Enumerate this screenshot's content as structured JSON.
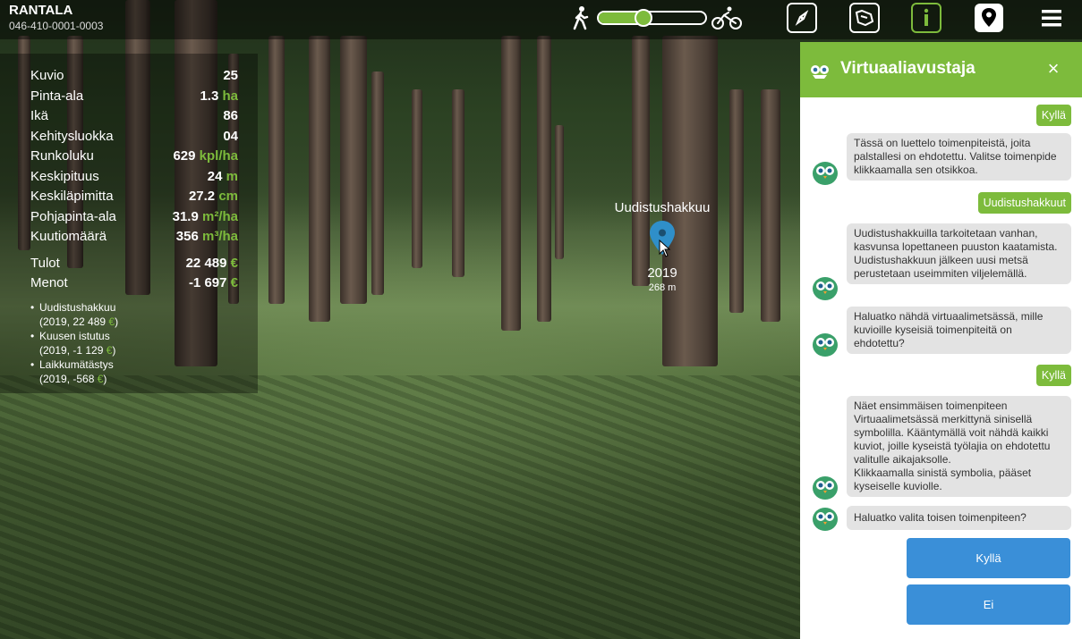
{
  "header": {
    "title": "RANTALA",
    "subtitle": "046-410-0001-0003"
  },
  "speed_slider": {
    "value_fraction": 0.42
  },
  "toolbar": {
    "buttons": [
      "compass-icon",
      "map-view-icon",
      "info-icon",
      "location-pin-icon",
      "menu-icon"
    ],
    "active": "info-icon"
  },
  "stats": {
    "rows": [
      {
        "label": "Kuvio",
        "value": "25",
        "unit": ""
      },
      {
        "label": "Pinta-ala",
        "value": "1.3",
        "unit": "ha"
      },
      {
        "label": "Ikä",
        "value": "86",
        "unit": ""
      },
      {
        "label": "Kehitysluokka",
        "value": "04",
        "unit": ""
      },
      {
        "label": "Runkoluku",
        "value": "629",
        "unit": "kpl/ha"
      },
      {
        "label": "Keskipituus",
        "value": "24",
        "unit": "m"
      },
      {
        "label": "Keskiläpimitta",
        "value": "27.2",
        "unit": "cm"
      },
      {
        "label": "Pohjapinta-ala",
        "value": "31.9",
        "unit": "m²/ha"
      },
      {
        "label": "Kuutiomäärä",
        "value": "356",
        "unit": "m³/ha"
      }
    ],
    "finance": [
      {
        "label": "Tulot",
        "value": "22 489",
        "unit": "€"
      },
      {
        "label": "Menot",
        "value": "-1 697",
        "unit": "€"
      }
    ],
    "bullets": [
      {
        "name": "Uudistushakkuu",
        "detail": "(2019, 22 489",
        "eur": "€",
        "close": ")"
      },
      {
        "name": "Kuusen istutus",
        "detail": "(2019, -1 129",
        "eur": "€",
        "close": ")"
      },
      {
        "name": "Laikkumätästys",
        "detail": "(2019, -568",
        "eur": "€",
        "close": ")"
      }
    ]
  },
  "marker": {
    "label": "Uudistushakkuu",
    "year": "2019",
    "distance": "268 m"
  },
  "assistant": {
    "title": "Virtuaaliavustaja",
    "close": "×",
    "messages": {
      "user0": "Kyllä",
      "bot1": "Tässä on luettelo toimenpiteistä, joita palstallesi on ehdotettu. Valitse toimenpide klikkaamalla sen otsikkoa.",
      "user1": "Uudistushakkuut",
      "bot2": "Uudistushakkuilla tarkoitetaan vanhan, kasvunsa lopettaneen puuston kaatamista. Uudistushakkuun jälkeen uusi metsä perustetaan useimmiten viljelemällä.",
      "bot3": "Haluatko nähdä virtuaalimetsässä, mille kuvioille kyseisiä toimenpiteitä on ehdotettu?",
      "user2": "Kyllä",
      "bot4a": "Näet ensimmäisen toimenpiteen Virtuaalimetsässä merkittynä sinisellä symbolilla. Kääntymällä voit nähdä kaikki kuviot, joille kyseistä työlajia on ehdotettu valitulle aikajaksolle.",
      "bot4b": "Klikkaamalla sinistä symbolia, pääset kyseiselle kuviolle.",
      "bot5": "Haluatko valita toisen toimenpiteen?"
    },
    "buttons": {
      "yes": "Kyllä",
      "no": "Ei"
    }
  },
  "colors": {
    "accent_green": "#7dbb3c",
    "button_blue": "#3a8fd8",
    "pin_blue": "#2f8fc9"
  }
}
